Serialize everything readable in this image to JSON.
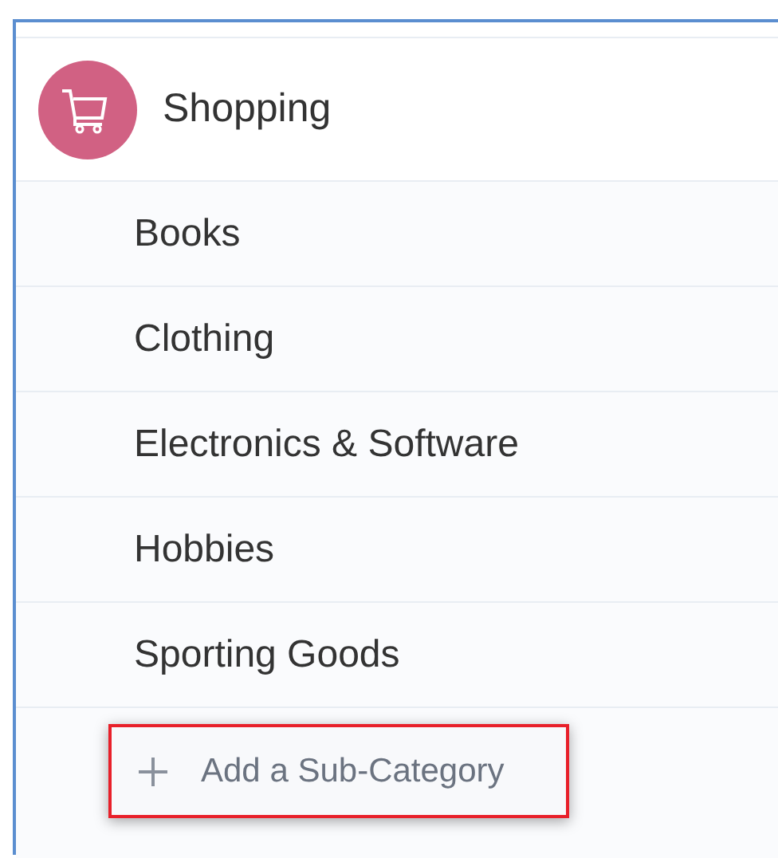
{
  "category": {
    "name": "Shopping"
  },
  "subcategories": [
    {
      "name": "Books"
    },
    {
      "name": "Clothing"
    },
    {
      "name": "Electronics & Software"
    },
    {
      "name": "Hobbies"
    },
    {
      "name": "Sporting Goods"
    }
  ],
  "add_button": {
    "label": "Add a Sub-Category"
  }
}
